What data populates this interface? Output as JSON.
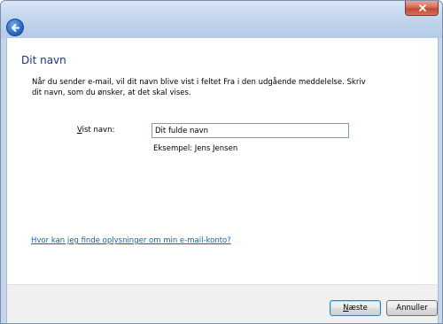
{
  "window": {
    "heading": "Dit navn",
    "intro": "Når du sender e-mail, vil dit navn blive vist i feltet Fra i den udgående meddelelse. Skriv dit navn, som du ønsker, at det skal vises."
  },
  "form": {
    "label_accesskey": "V",
    "label_rest": "ist navn:",
    "name_value": "Dit fulde navn",
    "example": "Eksempel: Jens Jensen"
  },
  "help_link": "Hvor kan jeg finde oplysninger om min e-mail-konto?",
  "buttons": {
    "next_accesskey": "N",
    "next_rest": "æste",
    "cancel": "Annuller"
  },
  "colors": {
    "heading": "#1e3287",
    "link": "#0066cc",
    "frame": "#c4d6ec"
  },
  "icons": {
    "back": "back-arrow-icon",
    "close": "close-icon"
  }
}
